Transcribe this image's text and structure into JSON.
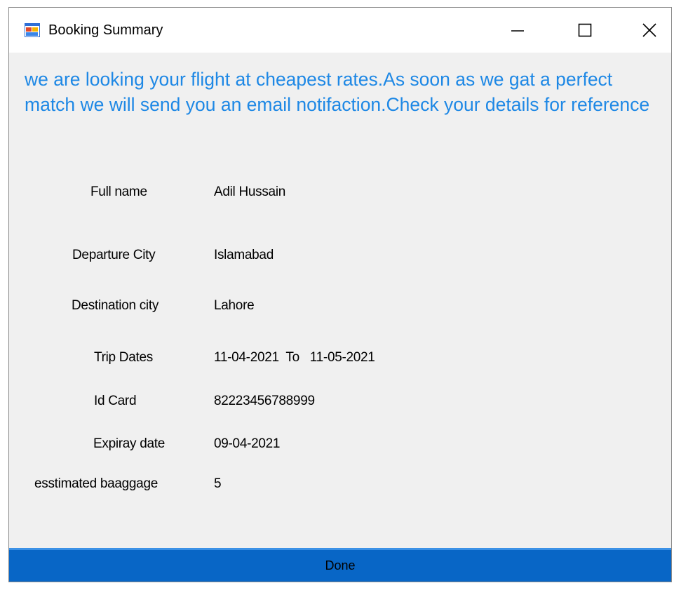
{
  "window": {
    "title": "Booking Summary",
    "icons": {
      "app": "app-form-icon",
      "minimize": "minimize-icon",
      "maximize": "maximize-icon",
      "close": "close-icon"
    }
  },
  "message": "we are looking your flight at cheapest rates.As soon as we gat a perfect match we will send you an email notifaction.Check your details for reference",
  "details": {
    "full_name": {
      "label": "Full name",
      "value": "Adil Hussain"
    },
    "departure_city": {
      "label": "Departure City",
      "value": "Islamabad"
    },
    "destination_city": {
      "label": "Destination city",
      "value": "Lahore"
    },
    "trip_dates": {
      "label": "Trip Dates",
      "value": "11-04-2021  To   11-05-2021"
    },
    "id_card": {
      "label": "Id Card",
      "value": "82223456788999"
    },
    "expiry_date": {
      "label": "Expiray date",
      "value": "09-04-2021"
    },
    "baggage": {
      "label": "esstimated baaggage",
      "value": "5"
    }
  },
  "done_label": "Done",
  "colors": {
    "message": "#1e88e5",
    "done_button": "#0866c6",
    "window_bg": "#f0f0f0"
  }
}
